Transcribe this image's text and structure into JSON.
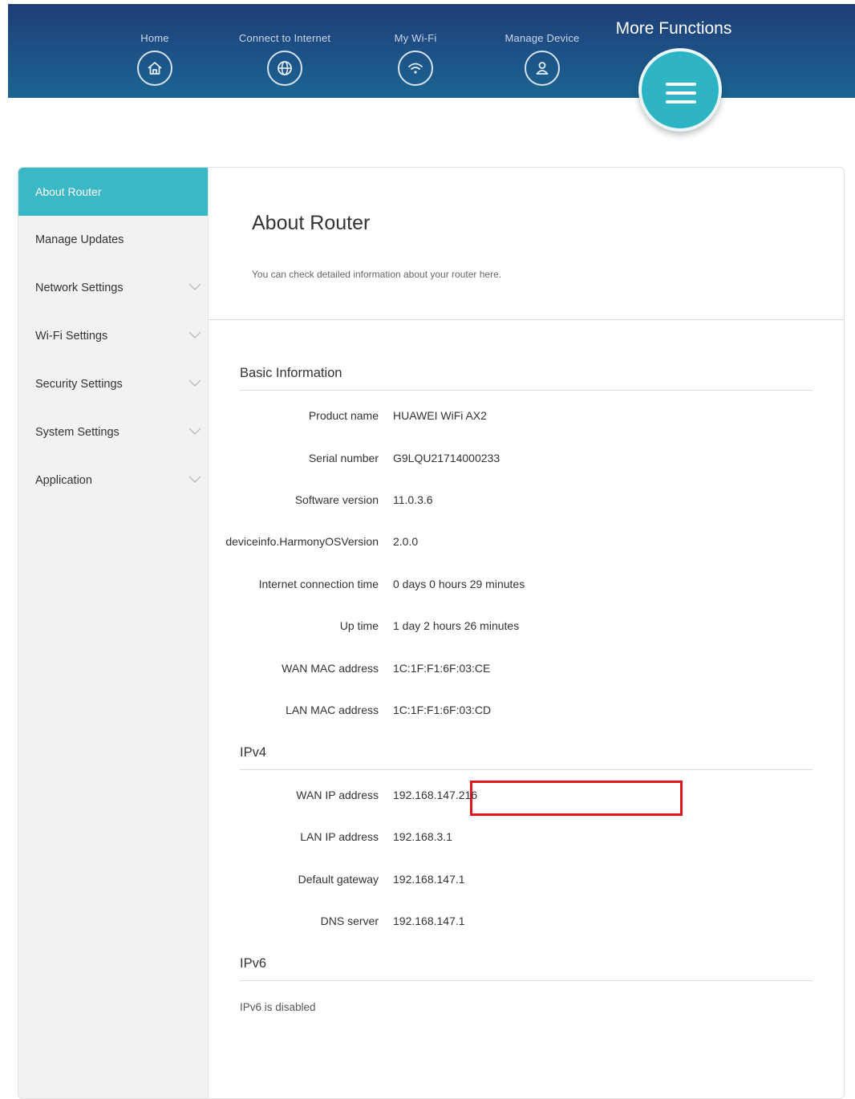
{
  "topnav": {
    "items": [
      {
        "label": "Home",
        "icon": "home-icon"
      },
      {
        "label": "Connect to Internet",
        "icon": "globe-icon"
      },
      {
        "label": "My Wi-Fi",
        "icon": "wifi-icon"
      },
      {
        "label": "Manage Device",
        "icon": "user-icon"
      }
    ],
    "more_label": "More Functions",
    "more_icon": "menu-icon"
  },
  "sidebar": {
    "items": [
      {
        "label": "About Router",
        "active": true
      },
      {
        "label": "Manage Updates"
      },
      {
        "label": "Network Settings",
        "expandable": true
      },
      {
        "label": "Wi-Fi Settings",
        "expandable": true
      },
      {
        "label": "Security Settings",
        "expandable": true
      },
      {
        "label": "System Settings",
        "expandable": true
      },
      {
        "label": "Application",
        "expandable": true
      }
    ]
  },
  "page": {
    "title": "About Router",
    "description": "You can check detailed information about your router here."
  },
  "basic": {
    "title": "Basic Information",
    "rows": [
      {
        "label": "Product name",
        "value": "HUAWEI WiFi AX2"
      },
      {
        "label": "Serial number",
        "value": "G9LQU21714000233"
      },
      {
        "label": "Software version",
        "value": "11.0.3.6"
      },
      {
        "label": "deviceinfo.HarmonyOSVersion",
        "value": "2.0.0"
      },
      {
        "label": "Internet connection time",
        "value": "0 days 0 hours 29 minutes"
      },
      {
        "label": "Up time",
        "value": "1 day 2 hours 26 minutes"
      },
      {
        "label": "WAN MAC address",
        "value": "1C:1F:F1:6F:03:CE"
      },
      {
        "label": "LAN MAC address",
        "value": "1C:1F:F1:6F:03:CD"
      }
    ]
  },
  "ipv4": {
    "title": "IPv4",
    "rows": [
      {
        "label": "WAN IP address",
        "value": "192.168.147.216"
      },
      {
        "label": "LAN IP address",
        "value": "192.168.3.1"
      },
      {
        "label": "Default gateway",
        "value": "192.168.147.1"
      },
      {
        "label": "DNS server",
        "value": "192.168.147.1"
      }
    ]
  },
  "ipv6": {
    "title": "IPv6",
    "status": "IPv6 is disabled"
  },
  "colors": {
    "header_top": "#1f3d78",
    "header_bottom": "#1b6593",
    "accent": "#3bb8c6",
    "highlight": "#e3161e"
  }
}
